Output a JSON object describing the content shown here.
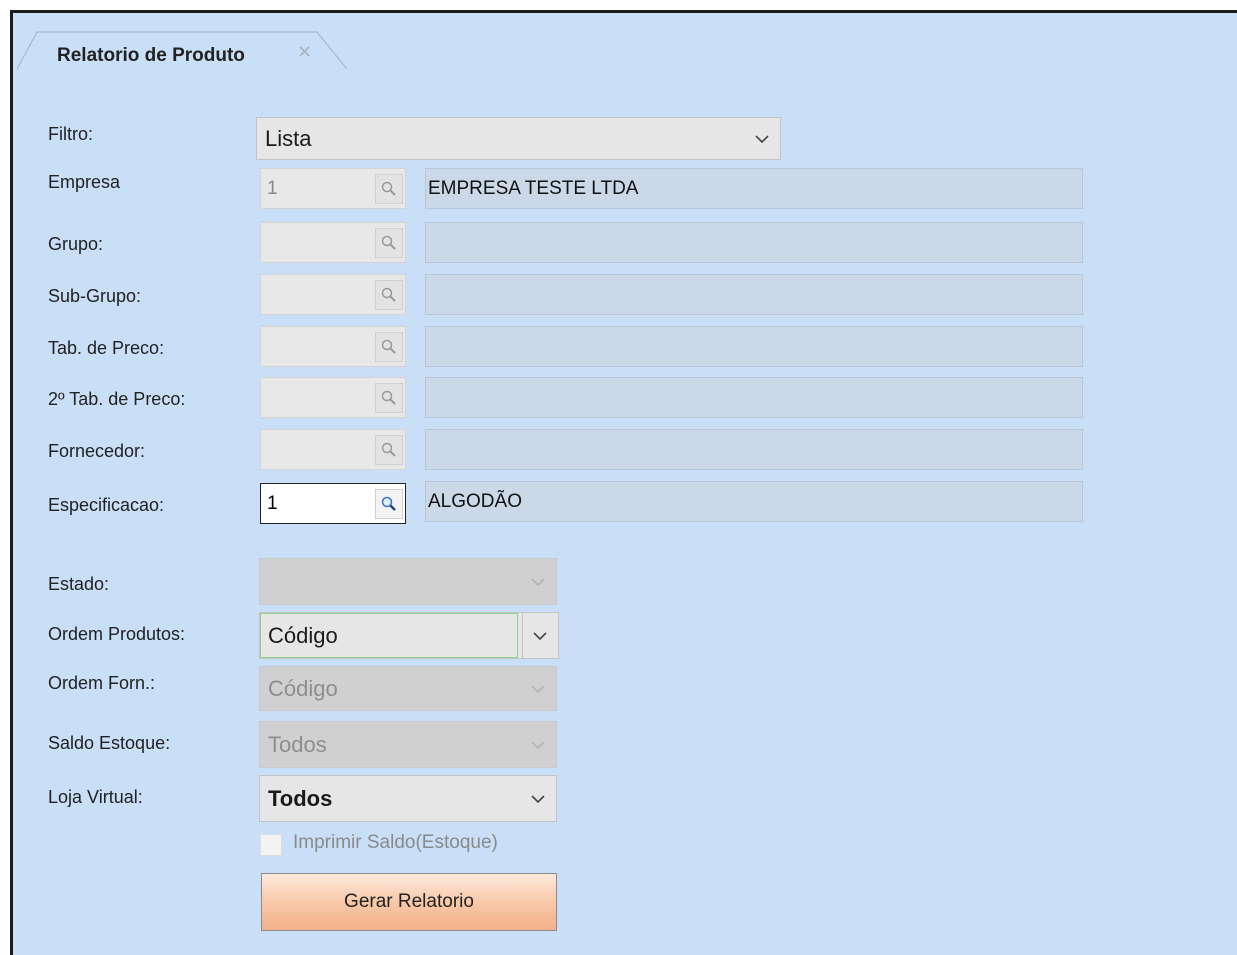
{
  "tab": {
    "title": "Relatorio de Produto",
    "close_glyph": "✕"
  },
  "form": {
    "filtro": {
      "label": "Filtro:",
      "value": "Lista"
    },
    "empresa": {
      "label": "Empresa",
      "code": "1",
      "description": "EMPRESA TESTE LTDA"
    },
    "grupo": {
      "label": "Grupo:",
      "code": "",
      "description": ""
    },
    "subgrupo": {
      "label": "Sub-Grupo:",
      "code": "",
      "description": ""
    },
    "tab_preco": {
      "label": "Tab. de Preco:",
      "code": "",
      "description": ""
    },
    "tab_preco2": {
      "label": "2º Tab. de Preco:",
      "code": "",
      "description": ""
    },
    "fornecedor": {
      "label": "Fornecedor:",
      "code": "",
      "description": ""
    },
    "especificacao": {
      "label": "Especificacao:",
      "code": "1",
      "description": "ALGODÃO"
    },
    "estado": {
      "label": "Estado:",
      "value": ""
    },
    "ordem_produtos": {
      "label": "Ordem Produtos:",
      "value": "Código"
    },
    "ordem_forn": {
      "label": "Ordem Forn.:",
      "value": "Código"
    },
    "saldo_estoque": {
      "label": "Saldo Estoque:",
      "value": "Todos"
    },
    "loja_virtual": {
      "label": "Loja Virtual:",
      "value": "Todos"
    },
    "imprimir_saldo": {
      "label": "Imprimir Saldo(Estoque)",
      "checked": false
    },
    "gerar_button": "Gerar Relatorio"
  },
  "icons": {
    "lookup": "magnifier-icon",
    "dropdown": "chevron-down-icon",
    "close": "close-icon"
  },
  "colors": {
    "panel_bg": "#c9def7",
    "button_gradient_end": "#f4b08a",
    "focus_border": "#8fd18f"
  }
}
